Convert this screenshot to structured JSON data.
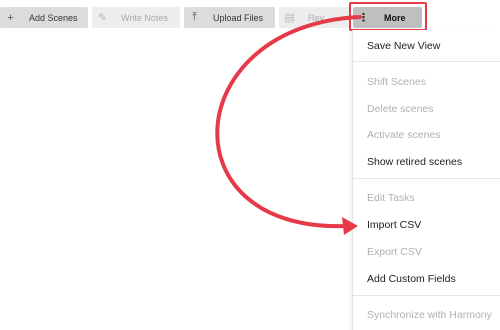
{
  "toolbar": {
    "add_scenes": "Add Scenes",
    "write_notes": "Write Notes",
    "upload_files": "Upload Files",
    "rev_partial": "Rev",
    "more": "More",
    "icons": {
      "add": "+",
      "write": "✎",
      "upload": "⤒",
      "rev": "▤",
      "more": "⋮"
    }
  },
  "menu": {
    "items": [
      {
        "label": "Save New View",
        "enabled": true
      },
      {
        "label": "Shift Scenes",
        "enabled": false
      },
      {
        "label": "Delete scenes",
        "enabled": false
      },
      {
        "label": "Activate scenes",
        "enabled": false
      },
      {
        "label": "Show retired scenes",
        "enabled": true
      },
      {
        "label": "Edit Tasks",
        "enabled": false
      },
      {
        "label": "Import CSV",
        "enabled": true
      },
      {
        "label": "Export CSV",
        "enabled": false
      },
      {
        "label": "Add Custom Fields",
        "enabled": true
      },
      {
        "label": "Synchronize with Harmony",
        "enabled": false
      }
    ]
  },
  "annotation": {
    "color": "#e63b47"
  }
}
